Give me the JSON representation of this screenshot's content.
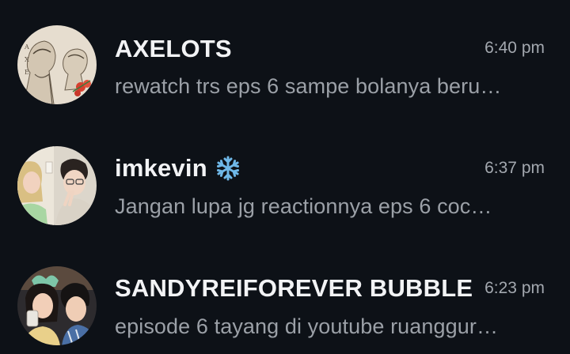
{
  "chats": [
    {
      "name": "AXELOTS",
      "time": "6:40 pm",
      "preview": "rewatch trs eps 6 sampe bolanya beru…",
      "avatar_icon": "sketch-art-avatar"
    },
    {
      "name": "imkevin",
      "name_emoji": "snowflake-icon",
      "time": "6:37 pm",
      "preview": "Jangan lupa jg reactionnya eps 6 coc…",
      "avatar_icon": "photo-avatar"
    },
    {
      "name": "SANDYREIFOREVER BUBBLE",
      "time": "6:23 pm",
      "preview": "episode 6 tayang di youtube ruanggur…",
      "avatar_icon": "photo-avatar"
    }
  ],
  "colors": {
    "background": "#0d1117",
    "name": "#f2f3f5",
    "preview": "#9ba0a7",
    "time": "#a3a8af",
    "snowflake": "#6fb8e8"
  }
}
